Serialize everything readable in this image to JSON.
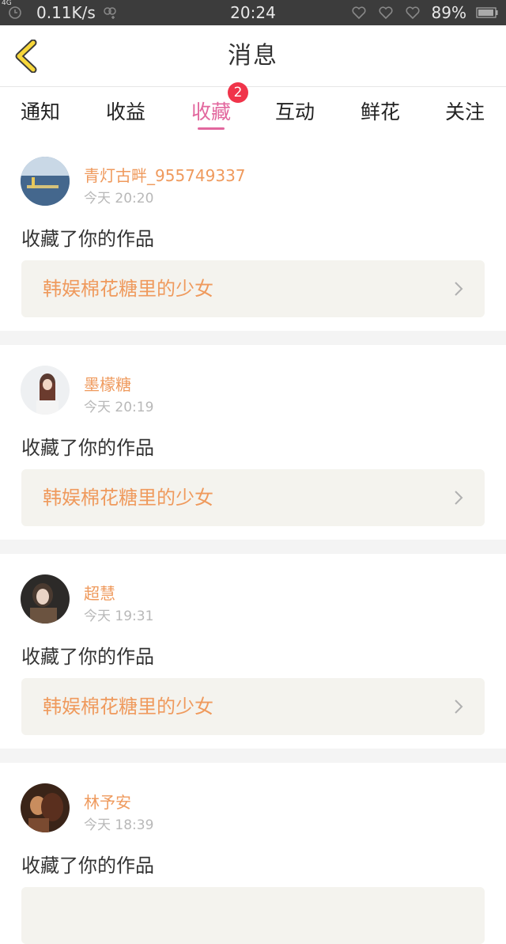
{
  "status_bar": {
    "network": "4G",
    "speed": "0.11K/s",
    "time": "20:24",
    "battery": "89%"
  },
  "header": {
    "title": "消息"
  },
  "tabs": [
    {
      "label": "通知"
    },
    {
      "label": "收益"
    },
    {
      "label": "收藏",
      "active": true,
      "badge": "2"
    },
    {
      "label": "互动"
    },
    {
      "label": "鲜花"
    },
    {
      "label": "关注"
    }
  ],
  "messages": [
    {
      "name": "青灯古畔_955749337",
      "time": "今天 20:20",
      "action": "收藏了你的作品",
      "work": "韩娱棉花糖里的少女"
    },
    {
      "name": "墨檬糖",
      "time": "今天 20:19",
      "action": "收藏了你的作品",
      "work": "韩娱棉花糖里的少女"
    },
    {
      "name": "超慧",
      "time": "今天 19:31",
      "action": "收藏了你的作品",
      "work": "韩娱棉花糖里的少女"
    },
    {
      "name": "林予安",
      "time": "今天 18:39",
      "action": "收藏了你的作品",
      "work": ""
    }
  ],
  "colors": {
    "accent": "#e2679e",
    "username": "#ef9a5d",
    "badge": "#f0344a",
    "statusbar": "#3c3c3c"
  }
}
